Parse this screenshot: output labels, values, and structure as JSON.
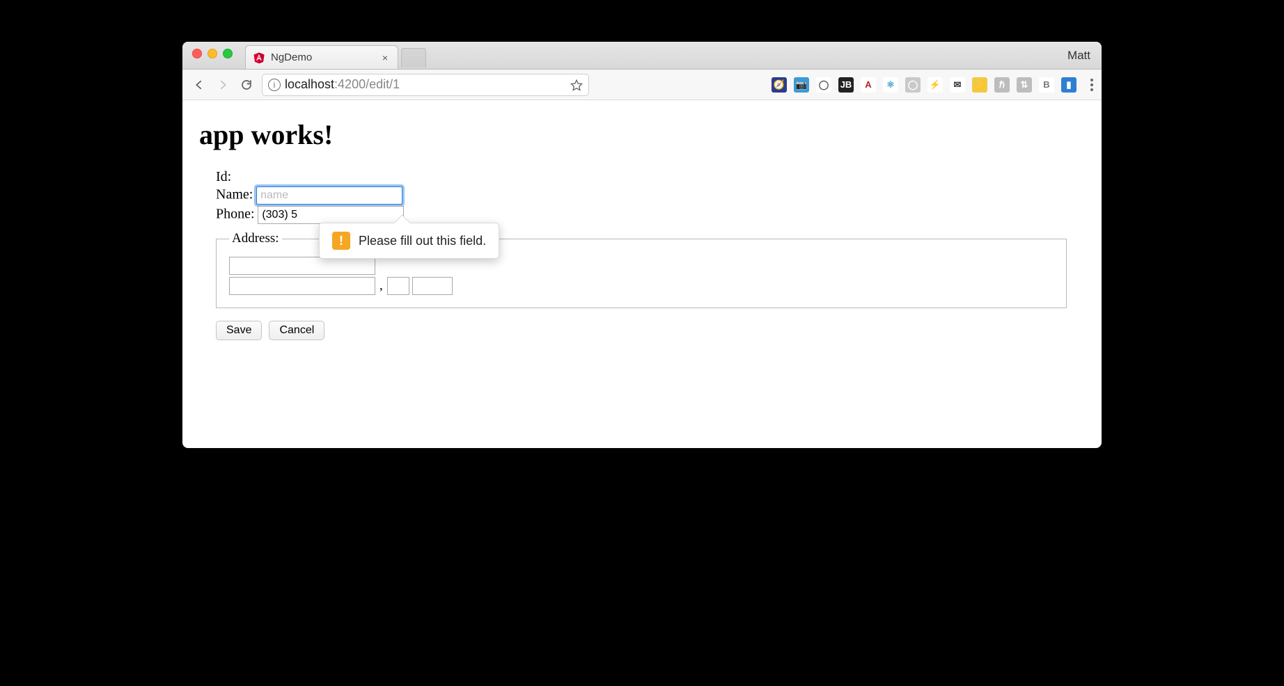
{
  "browser": {
    "tab": {
      "title": "NgDemo",
      "favicon": "angular"
    },
    "profile_name": "Matt",
    "url": {
      "host": "localhost",
      "rest": ":4200/edit/1"
    }
  },
  "page": {
    "heading": "app works!",
    "form": {
      "labels": {
        "id": "Id:",
        "name": "Name:",
        "phone": "Phone:"
      },
      "id_value": "",
      "name": {
        "value": "",
        "placeholder": "name"
      },
      "phone_value": "(303) 5",
      "address": {
        "legend": "Address:",
        "street": "",
        "city": "",
        "state": "",
        "zip": "",
        "comma": ","
      },
      "buttons": {
        "save": "Save",
        "cancel": "Cancel"
      }
    },
    "validation_message": "Please fill out this field."
  },
  "extensions": [
    {
      "name": "devtools",
      "bg": "#2d3b8e",
      "label": "🧭"
    },
    {
      "name": "screenshot",
      "bg": "#3c9ad6",
      "label": "📷"
    },
    {
      "name": "adblock",
      "bg": "#ffffff",
      "label": "◯",
      "fg": "#555"
    },
    {
      "name": "jetbrains",
      "bg": "#222",
      "label": "JB"
    },
    {
      "name": "fonts",
      "bg": "#ffffff",
      "label": "A",
      "fg": "#b22"
    },
    {
      "name": "react",
      "bg": "#ffffff",
      "label": "⚛",
      "fg": "#4aa3d6"
    },
    {
      "name": "circle",
      "bg": "#c9c9c9",
      "label": "◯"
    },
    {
      "name": "bolt",
      "bg": "#ffffff",
      "label": "⚡",
      "fg": "#cfcfcf"
    },
    {
      "name": "mail",
      "bg": "#ffffff",
      "label": "✉",
      "fg": "#333"
    },
    {
      "name": "moon",
      "bg": "#f5c842",
      "label": "🌙"
    },
    {
      "name": "hbar",
      "bg": "#bdbdbd",
      "label": "ℏ"
    },
    {
      "name": "exchange",
      "bg": "#bdbdbd",
      "label": "⇅"
    },
    {
      "name": "bold",
      "bg": "#ffffff",
      "label": "B",
      "fg": "#777"
    },
    {
      "name": "lighthouse",
      "bg": "#2f7fd1",
      "label": "▮"
    }
  ]
}
